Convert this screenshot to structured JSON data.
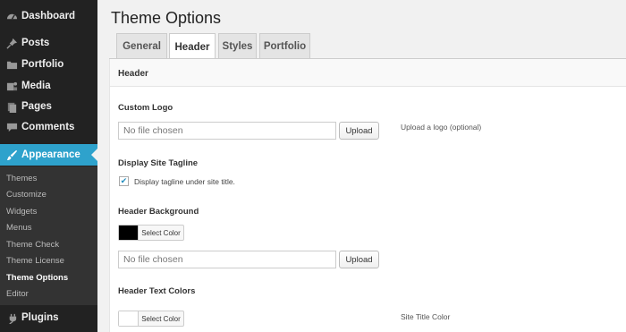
{
  "sidebar": {
    "items": [
      {
        "label": "Dashboard",
        "icon": "dashboard-icon"
      },
      {
        "label": "Posts",
        "icon": "pin-icon"
      },
      {
        "label": "Portfolio",
        "icon": "folder-icon"
      },
      {
        "label": "Media",
        "icon": "media-icon"
      },
      {
        "label": "Pages",
        "icon": "pages-icon"
      },
      {
        "label": "Comments",
        "icon": "comment-icon"
      },
      {
        "label": "Appearance",
        "icon": "brush-icon"
      },
      {
        "label": "Plugins",
        "icon": "plug-icon"
      }
    ],
    "submenu": [
      "Themes",
      "Customize",
      "Widgets",
      "Menus",
      "Theme Check",
      "Theme License",
      "Theme Options",
      "Editor"
    ],
    "active_color": "#2ea2cc"
  },
  "page": {
    "title": "Theme Options",
    "tabs": [
      "General",
      "Header",
      "Styles",
      "Portfolio"
    ],
    "active_tab": "Header"
  },
  "panel": {
    "title": "Header",
    "custom_logo": {
      "label": "Custom Logo",
      "file_value": "No file chosen",
      "button": "Upload",
      "description": "Upload a logo (optional)"
    },
    "tagline": {
      "label": "Display Site Tagline",
      "checkbox_label": "Display tagline under site title.",
      "checked": true
    },
    "header_background": {
      "label": "Header Background",
      "color_button": "Select Color",
      "swatch_color": "#000000",
      "file_value": "No file chosen",
      "button": "Upload"
    },
    "header_text_colors": {
      "label": "Header Text Colors",
      "color_button": "Select Color",
      "swatch_color": "#ffffff",
      "description": "Site Title Color"
    }
  }
}
